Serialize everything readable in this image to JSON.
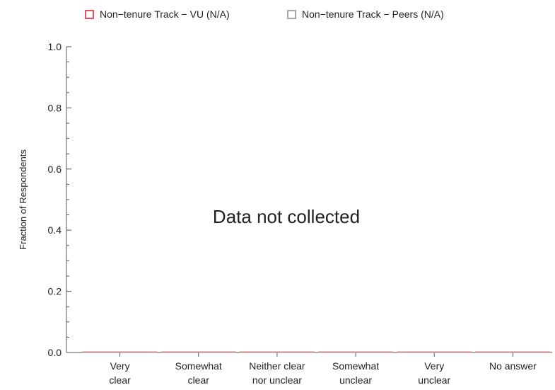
{
  "chart_data": {
    "type": "bar",
    "categories": [
      [
        "Very",
        "clear"
      ],
      [
        "Somewhat",
        "clear"
      ],
      [
        "Neither clear",
        "nor unclear"
      ],
      [
        "Somewhat",
        "unclear"
      ],
      [
        "Very",
        "unclear"
      ],
      [
        "No answer"
      ]
    ],
    "series": [
      {
        "name": "Non−tenure Track − VU (N/A)",
        "values": [
          0,
          0,
          0,
          0,
          0,
          0
        ],
        "color": "#e8505b"
      },
      {
        "name": "Non−tenure Track − Peers (N/A)",
        "values": [
          0,
          0,
          0,
          0,
          0,
          0
        ],
        "color": "#a6a6a6"
      }
    ],
    "ylabel": "Fraction of Respondents",
    "ylim": [
      0,
      1
    ],
    "yticks": [
      "0.0",
      "0.2",
      "0.4",
      "0.6",
      "0.8",
      "1.0"
    ],
    "annotation": "Data not collected",
    "legend_position": "top",
    "grid": false
  }
}
